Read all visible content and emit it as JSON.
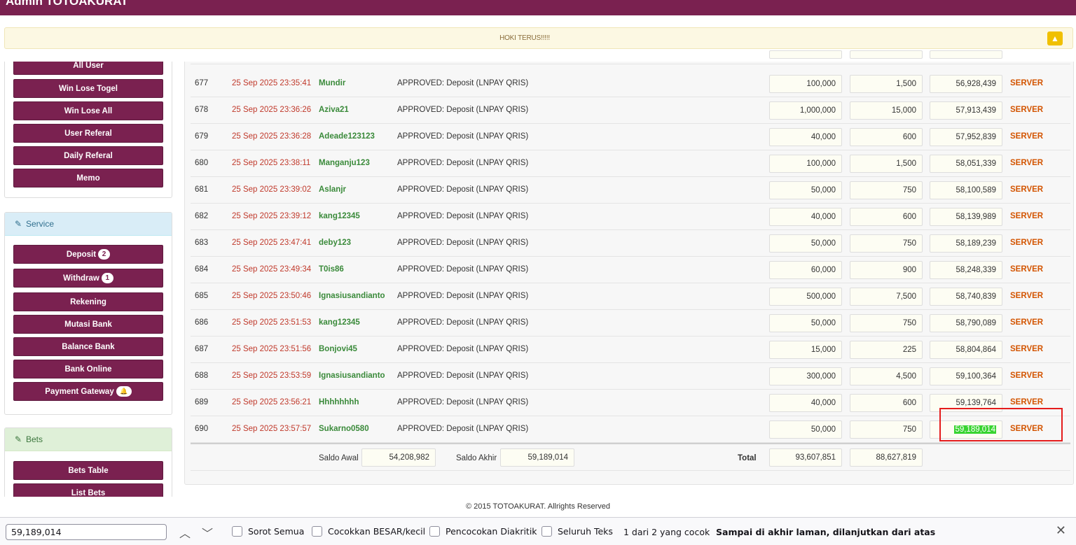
{
  "topbar": {
    "brand": "Admin TOTOAKURAT"
  },
  "banner": {
    "text": "HOKI TERUS!!!!!",
    "up_icon": "chevron-up-icon"
  },
  "sidebar": {
    "menu": [
      {
        "label": "All User"
      },
      {
        "label": "Win Lose Togel"
      },
      {
        "label": "Win Lose All"
      },
      {
        "label": "User Referal"
      },
      {
        "label": "Daily Referal"
      },
      {
        "label": "Memo"
      }
    ],
    "service": {
      "title": "Service",
      "items": [
        {
          "label": "Deposit",
          "badge": "2"
        },
        {
          "label": "Withdraw",
          "badge": "1"
        },
        {
          "label": "Rekening"
        },
        {
          "label": "Mutasi Bank"
        },
        {
          "label": "Balance Bank"
        },
        {
          "label": "Bank Online"
        },
        {
          "label": "Payment Gateway",
          "icon": "bell-icon"
        }
      ]
    },
    "bets": {
      "title": "Bets",
      "items": [
        {
          "label": "Bets Table"
        },
        {
          "label": "List Bets"
        }
      ]
    }
  },
  "table": {
    "rows": [
      {
        "no": "677",
        "date": "25 Sep 2025 23:35:41",
        "user": "Mundir",
        "desc": "APPROVED: Deposit (LNPAY QRIS)",
        "amount": "100,000",
        "fee": "1,500",
        "balance": "56,928,439",
        "source": "SERVER"
      },
      {
        "no": "678",
        "date": "25 Sep 2025 23:36:26",
        "user": "Aziva21",
        "desc": "APPROVED: Deposit (LNPAY QRIS)",
        "amount": "1,000,000",
        "fee": "15,000",
        "balance": "57,913,439",
        "source": "SERVER"
      },
      {
        "no": "679",
        "date": "25 Sep 2025 23:36:28",
        "user": "Adeade123123",
        "desc": "APPROVED: Deposit (LNPAY QRIS)",
        "amount": "40,000",
        "fee": "600",
        "balance": "57,952,839",
        "source": "SERVER"
      },
      {
        "no": "680",
        "date": "25 Sep 2025 23:38:11",
        "user": "Manganju123",
        "desc": "APPROVED: Deposit (LNPAY QRIS)",
        "amount": "100,000",
        "fee": "1,500",
        "balance": "58,051,339",
        "source": "SERVER"
      },
      {
        "no": "681",
        "date": "25 Sep 2025 23:39:02",
        "user": "Aslanjr",
        "desc": "APPROVED: Deposit (LNPAY QRIS)",
        "amount": "50,000",
        "fee": "750",
        "balance": "58,100,589",
        "source": "SERVER"
      },
      {
        "no": "682",
        "date": "25 Sep 2025 23:39:12",
        "user": "kang12345",
        "desc": "APPROVED: Deposit (LNPAY QRIS)",
        "amount": "40,000",
        "fee": "600",
        "balance": "58,139,989",
        "source": "SERVER"
      },
      {
        "no": "683",
        "date": "25 Sep 2025 23:47:41",
        "user": "deby123",
        "desc": "APPROVED: Deposit (LNPAY QRIS)",
        "amount": "50,000",
        "fee": "750",
        "balance": "58,189,239",
        "source": "SERVER"
      },
      {
        "no": "684",
        "date": "25 Sep 2025 23:49:34",
        "user": "T0is86",
        "desc": "APPROVED: Deposit (LNPAY QRIS)",
        "amount": "60,000",
        "fee": "900",
        "balance": "58,248,339",
        "source": "SERVER"
      },
      {
        "no": "685",
        "date": "25 Sep 2025 23:50:46",
        "user": "Ignasiusandianto",
        "desc": "APPROVED: Deposit (LNPAY QRIS)",
        "amount": "500,000",
        "fee": "7,500",
        "balance": "58,740,839",
        "source": "SERVER"
      },
      {
        "no": "686",
        "date": "25 Sep 2025 23:51:53",
        "user": "kang12345",
        "desc": "APPROVED: Deposit (LNPAY QRIS)",
        "amount": "50,000",
        "fee": "750",
        "balance": "58,790,089",
        "source": "SERVER"
      },
      {
        "no": "687",
        "date": "25 Sep 2025 23:51:56",
        "user": "Bonjovi45",
        "desc": "APPROVED: Deposit (LNPAY QRIS)",
        "amount": "15,000",
        "fee": "225",
        "balance": "58,804,864",
        "source": "SERVER"
      },
      {
        "no": "688",
        "date": "25 Sep 2025 23:53:59",
        "user": "Ignasiusandianto",
        "desc": "APPROVED: Deposit (LNPAY QRIS)",
        "amount": "300,000",
        "fee": "4,500",
        "balance": "59,100,364",
        "source": "SERVER"
      },
      {
        "no": "689",
        "date": "25 Sep 2025 23:56:21",
        "user": "Hhhhhhhh",
        "desc": "APPROVED: Deposit (LNPAY QRIS)",
        "amount": "40,000",
        "fee": "600",
        "balance": "59,139,764",
        "source": "SERVER"
      },
      {
        "no": "690",
        "date": "25 Sep 2025 23:57:57",
        "user": "Sukarno0580",
        "desc": "APPROVED: Deposit (LNPAY QRIS)",
        "amount": "50,000",
        "fee": "750",
        "balance": "59,189,014",
        "source": "SERVER",
        "highlight": true
      }
    ],
    "summary": {
      "saldo_awal_label": "Saldo Awal",
      "saldo_awal": "54,208,982",
      "saldo_akhir_label": "Saldo Akhir",
      "saldo_akhir": "59,189,014",
      "total_label": "Total",
      "total_amount": "93,607,851",
      "total_fee": "88,627,819"
    }
  },
  "footer": {
    "text": "© 2015 TOTOAKURAT. Allrights Reserved"
  },
  "findbar": {
    "query": "59,189,014",
    "options": [
      "Sorot Semua",
      "Cocokkan BESAR/kecil",
      "Pencocokan Diakritik",
      "Seluruh Teks"
    ],
    "status": "1 dari 2 yang cocok",
    "notice": "Sampai di akhir laman, dilanjutkan dari atas"
  }
}
